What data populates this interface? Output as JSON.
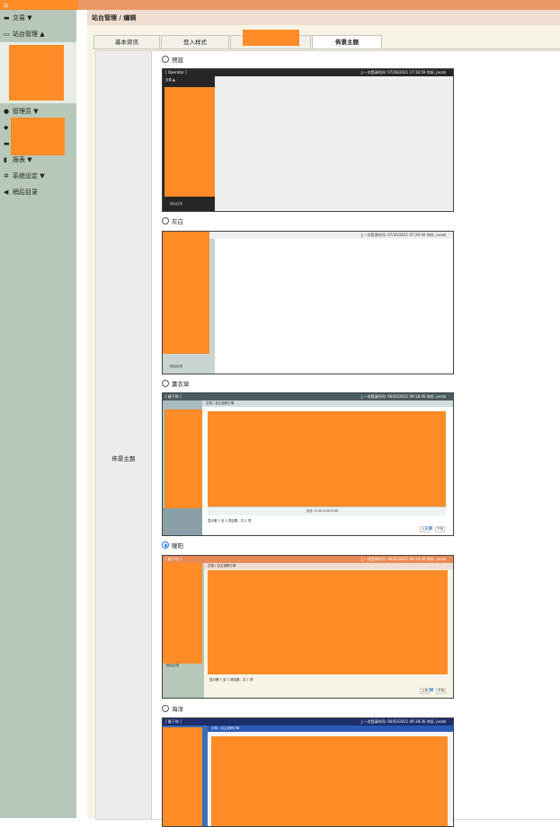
{
  "topbar": {
    "home_icon": "home-icon"
  },
  "sidebar": {
    "items": [
      {
        "icon": "money-icon",
        "label": "交易",
        "caret": "▼"
      },
      {
        "icon": "monitor-icon",
        "label": "站台管理",
        "caret": "▲"
      },
      {
        "icon": "user-icon",
        "label": "管理员",
        "caret": "▼"
      },
      {
        "icon": "tag-icon",
        "label": ""
      },
      {
        "icon": "card-icon",
        "label": ""
      },
      {
        "icon": "bar-chart-icon",
        "label": "报表",
        "caret": "▼"
      },
      {
        "icon": "gear-icon",
        "label": "系统设定",
        "caret": "▼"
      },
      {
        "icon": "back-icon",
        "label": "稍后目录"
      }
    ]
  },
  "breadcrumb": "站台管理 / 编辑",
  "tabs": [
    {
      "label": "基本资讯"
    },
    {
      "label": "登入样式"
    },
    {
      "label": ""
    },
    {
      "label": "佈景主题"
    }
  ],
  "form": {
    "field_label": "佈景主题",
    "options": [
      {
        "label": "预設",
        "selected": false
      },
      {
        "label": "灰白",
        "selected": false
      },
      {
        "label": "薰衣草",
        "selected": false
      },
      {
        "label": "暖阳",
        "selected": true
      },
      {
        "label": "海洋",
        "selected": false
      }
    ],
    "preview_text": {
      "operator": "[ Operator ]",
      "last_login_1": "上一次登录时间: 07/28/2021 17:16:59   你好, jacob",
      "last_login_2": "上一次登录时间: 07/30/2021 07:26:00   你好, jacob",
      "last_login_3": "上一次登录时间: 06/03/2021 09:18:36   你好, jacob",
      "nav_label": "交易 ▲",
      "back_label": "稍后目录",
      "crumb": "交易 / 自主追踪订单",
      "footer": "显示第 1 至 1 项结果，共 1 项",
      "totals": "合计: 0.00  0.00  0.00",
      "prev": "上页",
      "page": "1",
      "next": "下页",
      "brand": "[ 维下的 ]"
    }
  },
  "colors": {
    "redaction": "#ff8c26",
    "topbar": "#e99966",
    "sidebar": "#b7c8b8",
    "content_bg": "#f7f3e6"
  }
}
